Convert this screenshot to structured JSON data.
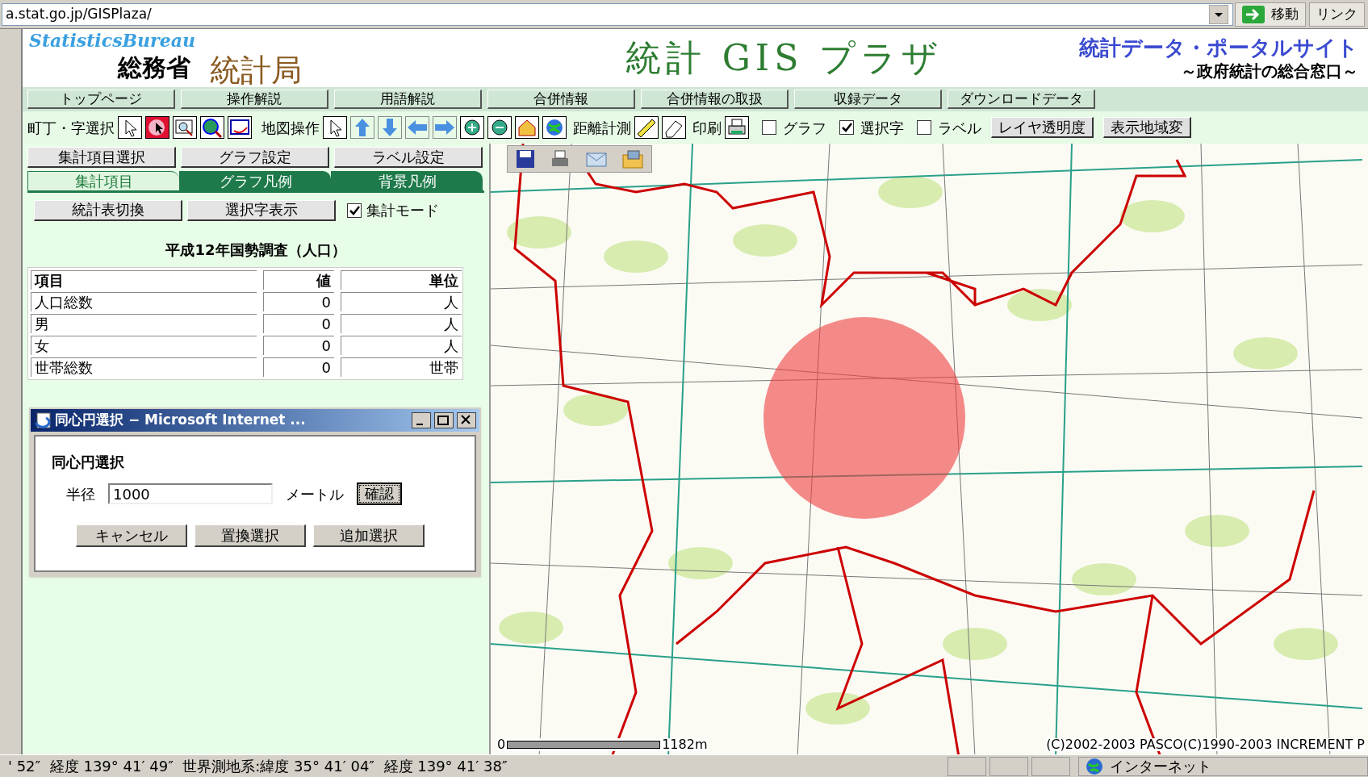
{
  "address_bar": {
    "url": "a.stat.go.jp/GISPlaza/",
    "go_button": "移動",
    "links": "リンク"
  },
  "header": {
    "brand_en": "StatisticsBureau",
    "ministry": "総務省",
    "bureau": "統計局",
    "title": "統計 GIS プラザ",
    "portal": "統計データ・ポータルサイト",
    "portal_sub": "～政府統計の総合窓口～"
  },
  "nav": [
    "トップページ",
    "操作解説",
    "用語解説",
    "合併情報",
    "合併情報の取扱",
    "収録データ",
    "ダウンロードデータ"
  ],
  "toolbar": {
    "select_label": "町丁・字選択",
    "map_label": "地図操作",
    "distance_label": "距離計測",
    "print_label": "印刷",
    "checks": [
      {
        "label": "グラフ",
        "checked": false
      },
      {
        "label": "選択字",
        "checked": true
      },
      {
        "label": "ラベル",
        "checked": false
      }
    ],
    "buttons": [
      "レイヤ透明度",
      "表示地域変"
    ]
  },
  "panel_buttons": [
    "集計項目選択",
    "グラフ設定",
    "ラベル設定"
  ],
  "tabs": [
    {
      "label": "集計項目",
      "selected": true
    },
    {
      "label": "グラフ凡例",
      "selected": false
    },
    {
      "label": "背景凡例",
      "selected": false
    }
  ],
  "sub_buttons": [
    "統計表切換",
    "選択字表示"
  ],
  "mode_check": {
    "label": "集計モード",
    "checked": true
  },
  "table": {
    "title": "平成12年国勢調査（人口）",
    "columns": [
      "項目",
      "値",
      "単位"
    ],
    "rows": [
      [
        "人口総数",
        "0",
        "人"
      ],
      [
        "男",
        "0",
        "人"
      ],
      [
        "女",
        "0",
        "人"
      ],
      [
        "世帯総数",
        "0",
        "世帯"
      ]
    ]
  },
  "dialog": {
    "title": "同心円選択 − Microsoft Internet ...",
    "heading": "同心円選択",
    "radius_label": "半径",
    "radius_value": "1000",
    "unit": "メートル",
    "confirm": "確認",
    "buttons": [
      "キャンセル",
      "置換選択",
      "追加選択"
    ]
  },
  "map": {
    "scale_zero": "0",
    "scale_label": "1182m",
    "copyright": "(C)2002-2003 PASCO(C)1990-2003 INCREMENT P"
  },
  "status_bar": {
    "coords": "' 52″  経度 139° 41′ 49″  世界測地系:緯度 35° 41′ 04″  経度 139° 41′ 38″",
    "zone": "インターネット"
  }
}
